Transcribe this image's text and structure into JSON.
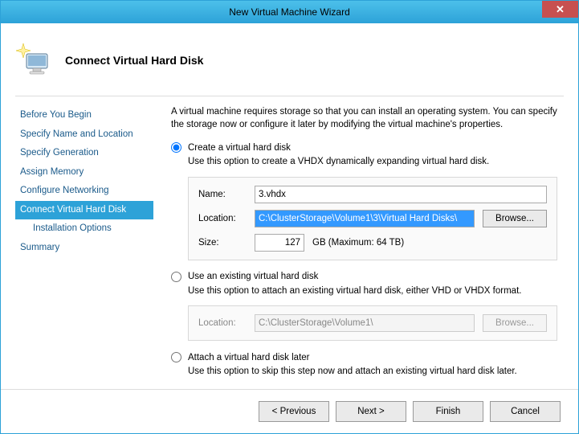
{
  "window": {
    "title": "New Virtual Machine Wizard"
  },
  "header": {
    "title": "Connect Virtual Hard Disk"
  },
  "sidebar": {
    "items": [
      {
        "label": "Before You Begin"
      },
      {
        "label": "Specify Name and Location"
      },
      {
        "label": "Specify Generation"
      },
      {
        "label": "Assign Memory"
      },
      {
        "label": "Configure Networking"
      },
      {
        "label": "Connect Virtual Hard Disk",
        "active": true
      },
      {
        "label": "Installation Options",
        "child": true
      },
      {
        "label": "Summary"
      }
    ]
  },
  "content": {
    "intro": "A virtual machine requires storage so that you can install an operating system. You can specify the storage now or configure it later by modifying the virtual machine's properties.",
    "opt1": {
      "label": "Create a virtual hard disk",
      "desc": "Use this option to create a VHDX dynamically expanding virtual hard disk.",
      "name_label": "Name:",
      "name_value": "3.vhdx",
      "location_label": "Location:",
      "location_value": "C:\\ClusterStorage\\Volume1\\3\\Virtual Hard Disks\\",
      "browse_label": "Browse...",
      "size_label": "Size:",
      "size_value": "127",
      "size_after": "GB (Maximum: 64 TB)"
    },
    "opt2": {
      "label": "Use an existing virtual hard disk",
      "desc": "Use this option to attach an existing virtual hard disk, either VHD or VHDX format.",
      "location_label": "Location:",
      "location_value": "C:\\ClusterStorage\\Volume1\\",
      "browse_label": "Browse..."
    },
    "opt3": {
      "label": "Attach a virtual hard disk later",
      "desc": "Use this option to skip this step now and attach an existing virtual hard disk later."
    }
  },
  "footer": {
    "previous": "< Previous",
    "next": "Next >",
    "finish": "Finish",
    "cancel": "Cancel"
  }
}
